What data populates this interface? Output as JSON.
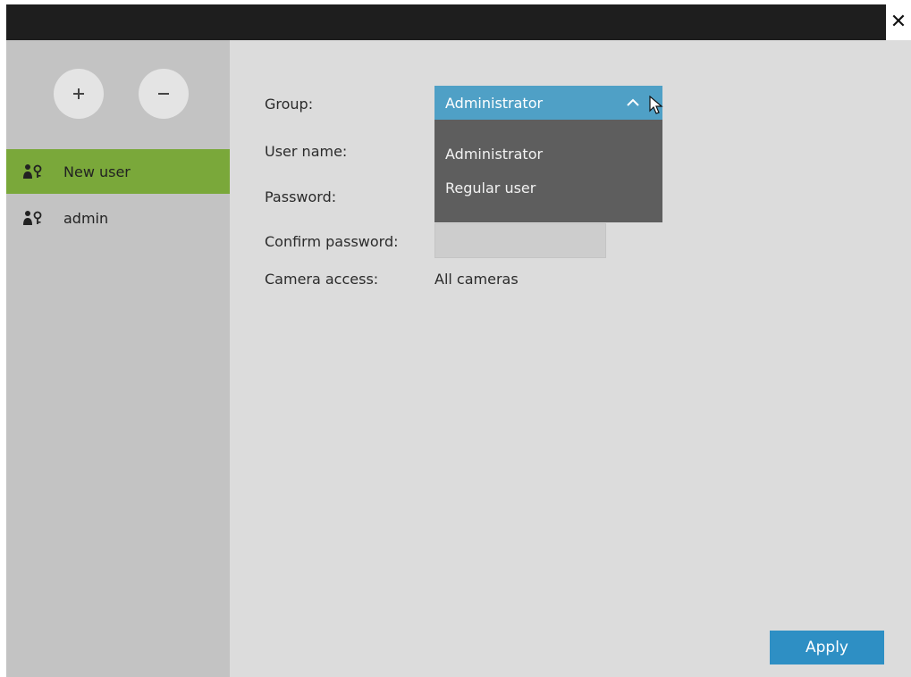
{
  "window": {
    "close_label": "✕"
  },
  "sidebar": {
    "add_button": "+",
    "remove_button": "−",
    "users": [
      {
        "label": "New user",
        "selected": true
      },
      {
        "label": "admin",
        "selected": false
      }
    ]
  },
  "form": {
    "group_label": "Group:",
    "username_label": "User name:",
    "password_label": "Password:",
    "confirm_label": "Confirm password:",
    "camera_access_label": "Camera access:",
    "camera_access_value": "All cameras"
  },
  "group_dropdown": {
    "selected": "Administrator",
    "options": [
      "Administrator",
      "Regular user"
    ]
  },
  "apply_label": "Apply",
  "colors": {
    "titlebar": "#1e1e1e",
    "sidebar": "#c3c3c3",
    "selected_user": "#7aa83a",
    "dropdown_selected": "#4fa0c6",
    "dropdown_menu": "#5e5e5e",
    "apply_button": "#2e8fc4"
  }
}
